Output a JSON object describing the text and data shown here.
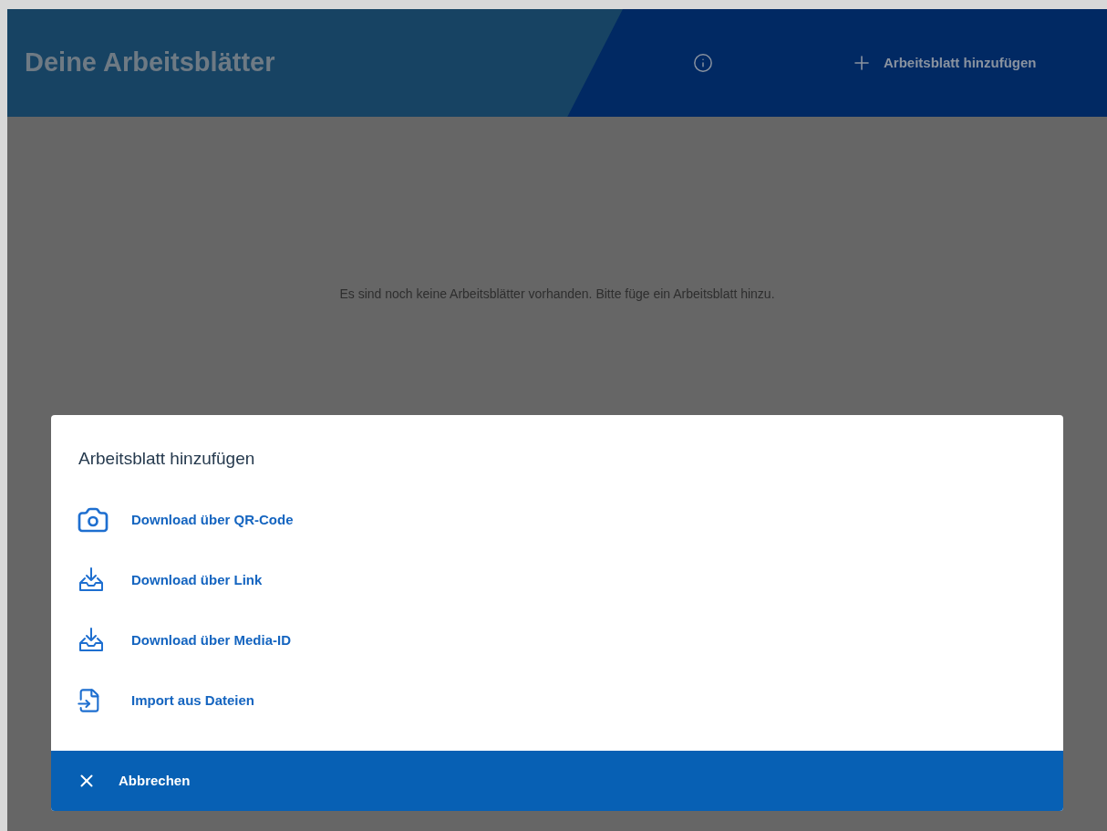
{
  "header": {
    "title": "Deine Arbeitsblätter",
    "add_button": "Arbeitsblatt hinzufügen"
  },
  "empty_message": "Es sind noch keine Arbeitsblätter vorhanden. Bitte füge ein Arbeitsblatt hinzu.",
  "dialog": {
    "title": "Arbeitsblatt hinzufügen",
    "options": [
      {
        "kind": "camera",
        "label": "Download über QR-Code"
      },
      {
        "kind": "download",
        "label": "Download über Link"
      },
      {
        "kind": "download",
        "label": "Download über Media-ID"
      },
      {
        "kind": "file",
        "label": "Import aus Dateien"
      }
    ],
    "cancel": "Abbrechen"
  }
}
